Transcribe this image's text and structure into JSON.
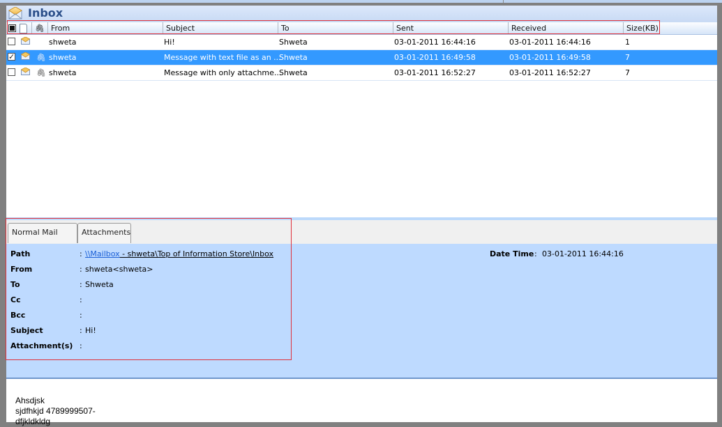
{
  "window": {
    "title": "Inbox",
    "title_icon": "inbox-envelope-icon"
  },
  "columns": {
    "check_icon": "select-all-checkbox",
    "doc_icon": "document-icon",
    "attach_icon": "paperclip-icon",
    "from": "From",
    "subject": "Subject",
    "to": "To",
    "sent": "Sent",
    "received": "Received",
    "size": "Size(KB)"
  },
  "messages": [
    {
      "checked": false,
      "has_attachment": false,
      "from": "shweta",
      "subject": "Hi!",
      "to": "Shweta",
      "sent": "03-01-2011 16:44:16",
      "received": "03-01-2011 16:44:16",
      "size": "1",
      "selected": false
    },
    {
      "checked": true,
      "has_attachment": true,
      "from": "shweta",
      "subject": "Message with text file as an ...",
      "to": "Shweta",
      "sent": "03-01-2011 16:49:58",
      "received": "03-01-2011 16:49:58",
      "size": "7",
      "selected": true
    },
    {
      "checked": false,
      "has_attachment": true,
      "from": "shweta",
      "subject": "Message with only attachme...",
      "to": "Shweta",
      "sent": "03-01-2011 16:52:27",
      "received": "03-01-2011 16:52:27",
      "size": "7",
      "selected": false
    }
  ],
  "tabs": [
    {
      "label": "Normal Mail View",
      "active": true
    },
    {
      "label": "Attachments",
      "active": false
    }
  ],
  "details": {
    "path_label": "Path",
    "path_link": "\\\\Mailbox",
    "path_rest": " - shweta\\Top of Information Store\\Inbox",
    "from_label": "From",
    "from_value": "shweta<shweta>",
    "to_label": "To",
    "to_value": "Shweta",
    "cc_label": "Cc",
    "cc_value": "",
    "bcc_label": "Bcc",
    "bcc_value": "",
    "subject_label": "Subject",
    "subject_value": "Hi!",
    "attachments_label": "Attachment(s)",
    "attachments_value": "",
    "datetime_label": "Date Time",
    "datetime_value": "03-01-2011 16:44:16",
    "colon": ":"
  },
  "body": {
    "lines": [
      "Ahsdjsk",
      "sjdfhkjd 4789999507-",
      "dfjkldkldg"
    ]
  },
  "colors": {
    "selection": "#3399ff",
    "details_bg": "#bedaff",
    "title_text": "#2b4f8a",
    "highlight_box": "#e0303a",
    "link": "#1a5fd6"
  }
}
